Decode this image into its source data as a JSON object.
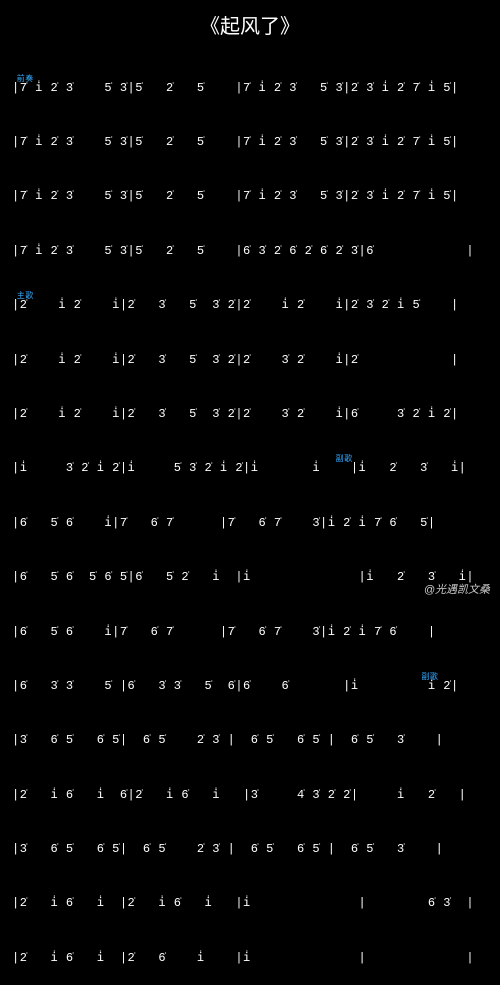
{
  "title": "《起风了》",
  "credit": "@光遇凯文桑",
  "labels": {
    "l1": "前奏",
    "l2": "主歌",
    "l3": "副歌",
    "l4": "副歌"
  },
  "rows": [
    "|7̇ i̇ 2̇ 3̇    5̇ 3̇|5̇   2̇   5̇    |7̇ i̇ 2̇ 3̇   5̇ 3̇|2̇ 3̇ i̇ 2̇ 7̇ i̇ 5̇|",
    "|7̇ i̇ 2̇ 3̇    5̇ 3̇|5̇   2̇   5̇    |7̇ i̇ 2̇ 3̇   5̇ 3̇|2̇ 3̇ i̇ 2̇ 7̇ i̇ 5̇|",
    "|7̇ i̇ 2̇ 3̇    5̇ 3̇|5̇   2̇   5̇    |7̇ i̇ 2̇ 3̇   5̇ 3̇|2̇ 3̇ i̇ 2̇ 7̇ i̇ 5̇|",
    "|7̇ i̇ 2̇ 3̇    5̇ 3̇|5̇   2̇   5̇    |6̇ 3̇ 2̇ 6̇ 2̇ 6̇ 2̇ 3̇|6̇            |",
    "|2̇    i̇ 2̇    i̇|2̇   3̇   5̇  3̇ 2̇|2̇    i̇ 2̇    i̇|2̇ 3̇ 2̇ i̇ 5̇    |",
    "|2̇    i̇ 2̇    i̇|2̇   3̇   5̇  3̇ 2̇|2̇    3̇ 2̇    i̇|2̇            |",
    "|2̇    i̇ 2̇    i̇|2̇   3̇   5̇  3̇ 2̇|2̇    3̇ 2̇    i̇|6̇     3̇ 2̇ i̇ 2̇|",
    "|i̇     3̇ 2̇ i̇ 2̇|i̇     5̇ 3̇ 2̇ i̇ 2̇|i̇       i̇    |i̇   2̇   3̇   i̇|",
    "|6̇   5̇ 6̇    i̇|7̇   6̇ 7̇      |7̇   6̇ 7̇    3̇|i̇ 2̇ i̇ 7̇ 6̇   5̇|",
    "|6̇   5̇ 6̇  5̇ 6̇ 5̇|6̇   5̇ 2̇   i̇  |i̇              |i̇   2̇   3̇   i̇|",
    "|6̇   5̇ 6̇    i̇|7̇   6̇ 7̇      |7̇   6̇ 7̇    3̇|i̇ 2̇ i̇ 7̇ 6̇    |",
    "|6̇   3̇ 3̇    5̇ |6̇   3̇ 3̇   5̇  6̇|6̇    6̇       |i̇         i̇ 2̇|",
    "|3̇   6̇ 5̇   6̇ 5̇|  6̇ 5̇    2̇ 3̇ |  6̇ 5̇   6̇ 5̇ |  6̇ 5̇   3̇    |",
    "|2̇   i̇ 6̇   i̇  6̇|2̇   i̇ 6̇   i̇   |3̇     4̇ 3̇ 2̇ 2̇|     i̇   2̇   |",
    "|3̇   6̇ 5̇   6̇ 5̇|  6̇ 5̇    2̇ 3̇ |  6̇ 5̇   6̇ 5̇ |  6̇ 5̇   3̇    |",
    "|2̇   i̇ 6̇   i̇  |2̇   i̇ 6̇   i̇   |i̇              |        6̇ 3̇  |",
    "|2̇   i̇ 6̇   i̇  |2̇   6̇    i̇    |i̇              |             |"
  ],
  "label_positions": {
    "l1": {
      "row": 0,
      "left": "1%"
    },
    "l2": {
      "row": 4,
      "left": "1%"
    },
    "l3": {
      "row": 7,
      "left": "68%"
    },
    "l4": {
      "row": 11,
      "left": "86%"
    }
  }
}
